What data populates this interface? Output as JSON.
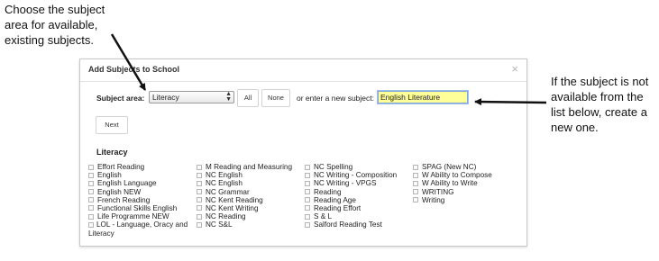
{
  "callouts": {
    "left": "Choose the subject area for available, existing subjects.",
    "right": "If the subject is not available from the list below, create a new one."
  },
  "dialog": {
    "title": "Add Subjects to School",
    "close_glyph": "×",
    "subject_area_label": "Subject area:",
    "subject_area_value": "Literacy",
    "all_label": "All",
    "none_label": "None",
    "or_text": "or enter a new subject:",
    "new_subject_value": "English Literature",
    "next_label": "Next",
    "section_heading": "Literacy",
    "columns": [
      [
        "Effort Reading",
        "English",
        "English Language",
        "English NEW",
        "French Reading",
        "Functional Skills English",
        "Life Programme NEW",
        "LOL - Language, Oracy and Literacy"
      ],
      [
        "M Reading and Measuring",
        "NC English",
        "NC English",
        "NC Grammar",
        "NC Kent Reading",
        "NC Kent Writing",
        "NC Reading",
        "NC S&L"
      ],
      [
        "NC Spelling",
        "NC Writing - Composition",
        "NC Writing - VPGS",
        "Reading",
        "Reading Age",
        "Reading Effort",
        "S & L",
        "Salford Reading Test"
      ],
      [
        "SPAG (New NC)",
        "W Ability to Compose",
        "W Ability to Write",
        "WRITING",
        "Writing"
      ]
    ]
  }
}
